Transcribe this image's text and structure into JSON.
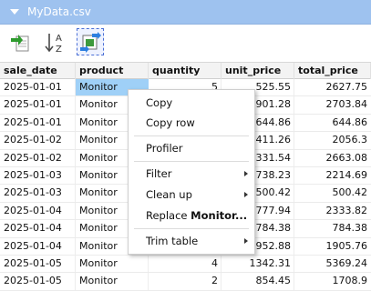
{
  "window": {
    "title": "MyData.csv"
  },
  "toolbar": {
    "buttons": [
      {
        "name": "export-icon"
      },
      {
        "name": "sort-az-icon",
        "glyph_top": "A",
        "glyph_bottom": "Z"
      },
      {
        "name": "transfer-icon"
      }
    ],
    "accent": "#4a6fd6"
  },
  "table": {
    "columns": [
      "sale_date",
      "product",
      "quantity",
      "unit_price",
      "total_price"
    ],
    "rows": [
      [
        "2025-01-01",
        "Monitor",
        "5",
        "525.55",
        "2627.75"
      ],
      [
        "2025-01-01",
        "Monitor",
        "",
        "901.28",
        "2703.84"
      ],
      [
        "2025-01-01",
        "Monitor",
        "",
        "644.86",
        "644.86"
      ],
      [
        "2025-01-02",
        "Monitor",
        "",
        "411.26",
        "2056.3"
      ],
      [
        "2025-01-02",
        "Monitor",
        "",
        "1331.54",
        "2663.08"
      ],
      [
        "2025-01-03",
        "Monitor",
        "",
        "738.23",
        "2214.69"
      ],
      [
        "2025-01-03",
        "Monitor",
        "",
        "500.42",
        "500.42"
      ],
      [
        "2025-01-04",
        "Monitor",
        "",
        "777.94",
        "2333.82"
      ],
      [
        "2025-01-04",
        "Monitor",
        "",
        "784.38",
        "784.38"
      ],
      [
        "2025-01-04",
        "Monitor",
        "",
        "952.88",
        "1905.76"
      ],
      [
        "2025-01-05",
        "Monitor",
        "4",
        "1342.31",
        "5369.24"
      ],
      [
        "2025-01-05",
        "Monitor",
        "2",
        "854.45",
        "1708.9"
      ]
    ],
    "selection_color": "#9fd0f7"
  },
  "context_menu": {
    "items": [
      {
        "label": "Copy"
      },
      {
        "label": "Copy row"
      },
      {
        "label": "Profiler"
      },
      {
        "label": "Filter",
        "submenu": true
      },
      {
        "label": "Clean up",
        "submenu": true
      },
      {
        "label_prefix": "Replace ",
        "label_bold": "Monitor..."
      },
      {
        "label": "Trim table",
        "submenu": true
      }
    ]
  }
}
